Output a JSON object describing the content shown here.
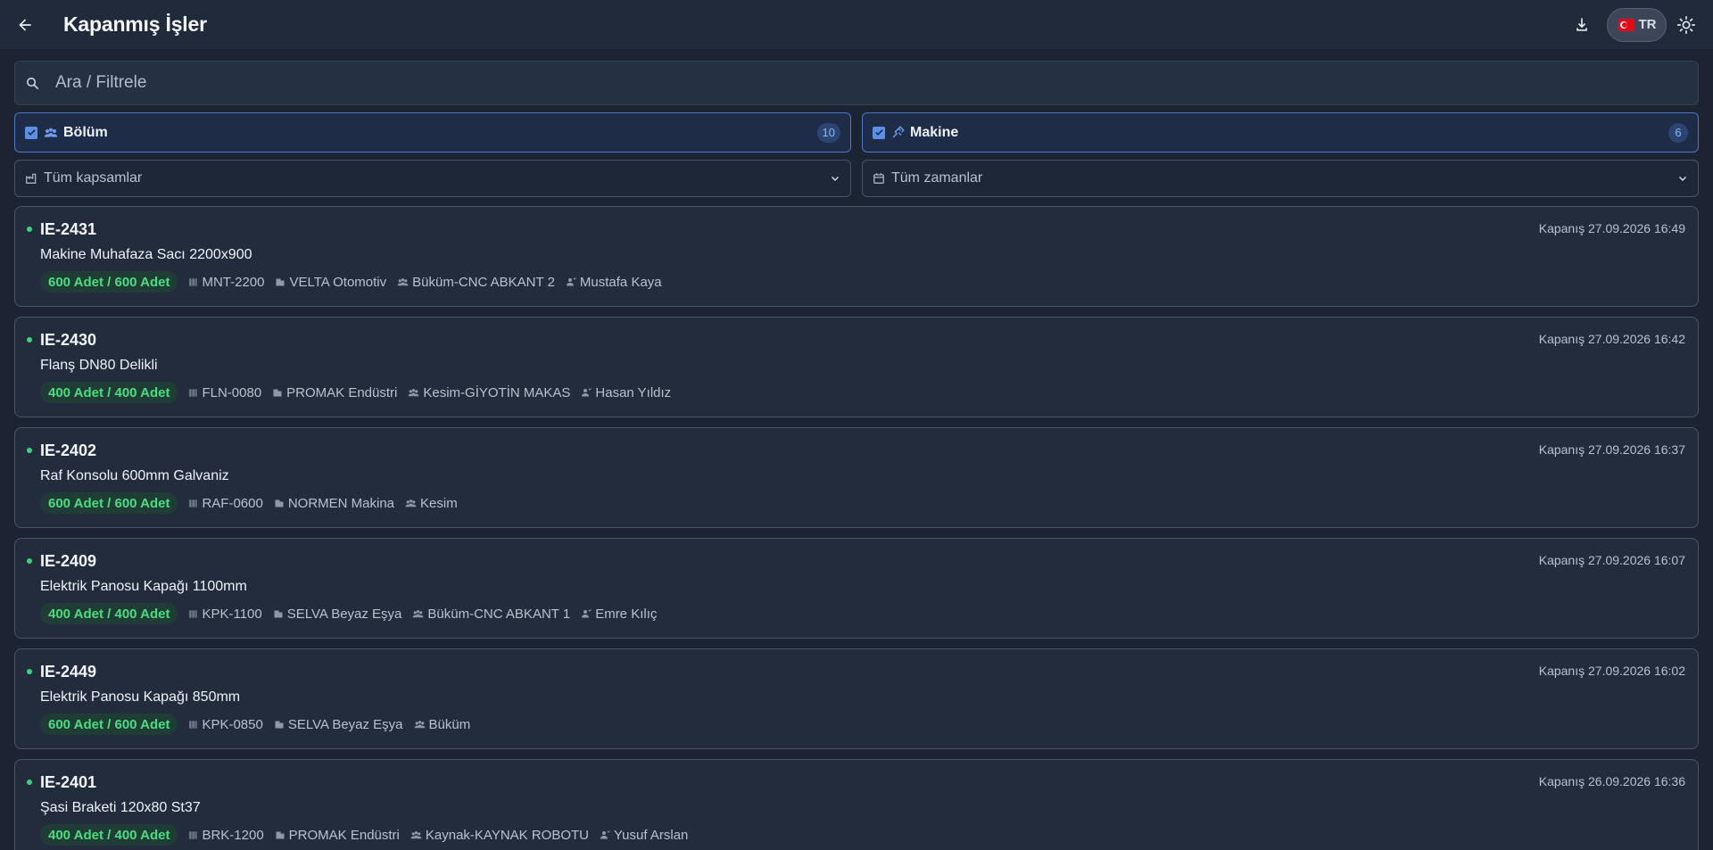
{
  "header": {
    "title": "Kapanmış İşler",
    "back_icon": "arrow-left-icon",
    "download_icon": "download-icon",
    "lang_label": "TR",
    "theme_icon": "sun-icon"
  },
  "search": {
    "placeholder": "Ara / Filtrele",
    "value": ""
  },
  "groups": [
    {
      "label": "Bölüm",
      "count": "10",
      "checked": true,
      "icon": "people-icon"
    },
    {
      "label": "Makine",
      "count": "6",
      "checked": true,
      "icon": "machine-icon"
    }
  ],
  "filters": {
    "scope": "Tüm kapsamlar",
    "time": "Tüm zamanlar"
  },
  "colors": {
    "accent": "#5b8fe8",
    "success": "#4ade80",
    "background": "#1c2433"
  },
  "jobs": [
    {
      "id": "IE-2431",
      "closed": "Kapanış 27.09.2026 16:49",
      "name": "Makine Muhafaza Sacı 2200x900",
      "qty": "600 Adet / 600 Adet",
      "code": "MNT-2200",
      "customer": "VELTA Otomotiv",
      "station": "Büküm-CNC ABKANT 2",
      "operator": "Mustafa Kaya"
    },
    {
      "id": "IE-2430",
      "closed": "Kapanış 27.09.2026 16:42",
      "name": "Flanş DN80 Delikli",
      "qty": "400 Adet / 400 Adet",
      "code": "FLN-0080",
      "customer": "PROMAK Endüstri",
      "station": "Kesim-GİYOTİN MAKAS",
      "operator": "Hasan Yıldız"
    },
    {
      "id": "IE-2402",
      "closed": "Kapanış 27.09.2026 16:37",
      "name": "Raf Konsolu 600mm Galvaniz",
      "qty": "600 Adet / 600 Adet",
      "code": "RAF-0600",
      "customer": "NORMEN Makina",
      "station": "Kesim",
      "operator": ""
    },
    {
      "id": "IE-2409",
      "closed": "Kapanış 27.09.2026 16:07",
      "name": "Elektrik Panosu Kapağı 1100mm",
      "qty": "400 Adet / 400 Adet",
      "code": "KPK-1100",
      "customer": "SELVA Beyaz Eşya",
      "station": "Büküm-CNC ABKANT 1",
      "operator": "Emre Kılıç"
    },
    {
      "id": "IE-2449",
      "closed": "Kapanış 27.09.2026 16:02",
      "name": "Elektrik Panosu Kapağı 850mm",
      "qty": "600 Adet / 600 Adet",
      "code": "KPK-0850",
      "customer": "SELVA Beyaz Eşya",
      "station": "Büküm",
      "operator": ""
    },
    {
      "id": "IE-2401",
      "closed": "Kapanış 26.09.2026 16:36",
      "name": "Şasi Braketi 120x80 St37",
      "qty": "400 Adet / 400 Adet",
      "code": "BRK-1200",
      "customer": "PROMAK Endüstri",
      "station": "Kaynak-KAYNAK ROBOTU",
      "operator": "Yusuf Arslan"
    }
  ]
}
